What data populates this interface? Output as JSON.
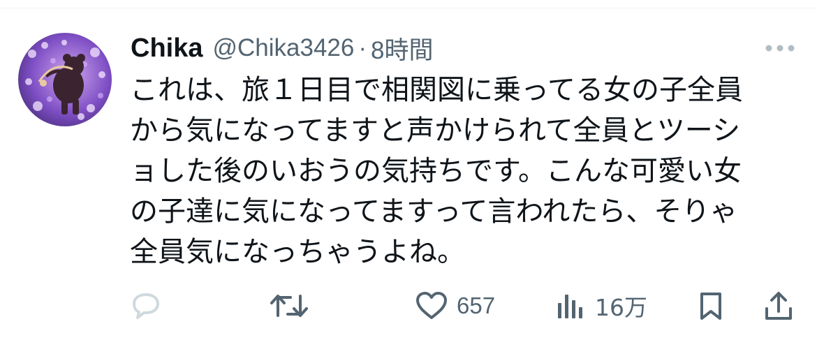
{
  "tweet": {
    "display_name": "Chika",
    "handle": "@Chika3426",
    "separator": "·",
    "timestamp": "8時間",
    "text_lines": [
      "これは、旅１日目で相関図に乗ってる女の子全員",
      "から気になってますと声かけられて全員とツーシ",
      "ョした後のいおうの気持ちです。こんな可愛い女",
      "の子達に気になってますって言われたら、そりゃ",
      "全員気になっちゃうよね。"
    ]
  },
  "actions": {
    "reply": {
      "icon": "reply-icon"
    },
    "retweet": {
      "icon": "retweet-icon"
    },
    "like": {
      "icon": "heart-icon",
      "count": "657"
    },
    "views": {
      "icon": "views-icon",
      "count": "16万"
    },
    "bookmark": {
      "icon": "bookmark-icon"
    },
    "share": {
      "icon": "share-icon"
    }
  },
  "colors": {
    "text_primary": "#0f1419",
    "text_secondary": "#536471",
    "reply_icon_muted": "#cfd9de",
    "divider": "#eff3f4"
  }
}
